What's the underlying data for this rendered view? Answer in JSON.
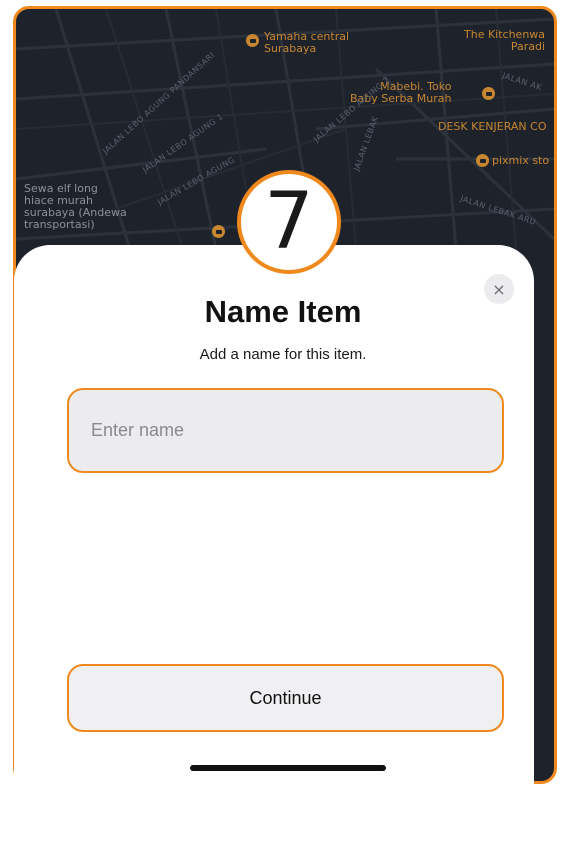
{
  "map": {
    "places": [
      {
        "name": "Yamaha central Surabaya"
      },
      {
        "name": "The Kitchenw… Paradi…"
      },
      {
        "name": "Mabebi. Toko Baby Serba Murah"
      },
      {
        "name": "DESK KENJERAN CO"
      },
      {
        "name": "pixmix sto"
      },
      {
        "name": "Sewa elf long hiace murah surabaya (Andewa transportasi)"
      }
    ],
    "streets": [
      "JALAN LEBO AGUNG PANDANSARI",
      "JALAN LEBO AGUNG 1",
      "JALAN LEBO AGUNG",
      "JALAN LEBO AGUNG 2",
      "JALAN LEBAK",
      "JALAN LEBAK ARU",
      "JALAN AK"
    ],
    "labels": {
      "yamaha": "Yamaha central\nSurabaya",
      "kitchen": "The Kitchenwa\nParadi",
      "mabebi": "Mabebi. Toko\nBaby Serba Murah",
      "desk": "DESK KENJERAN CO",
      "pixmix": "pixmix sto",
      "sewa": "Sewa elf long\nhiace murah\nsurabaya (Andewa\ntransportasi)"
    }
  },
  "step": {
    "number": "7"
  },
  "sheet": {
    "title": "Name Item",
    "subtitle": "Add a name for this item.",
    "close_glyph": "×",
    "input": {
      "placeholder": "Enter name",
      "value": ""
    },
    "continue_label": "Continue"
  },
  "colors": {
    "accent": "#f0891d",
    "map_background": "#1e232b",
    "map_label": "#c7862f",
    "input_background": "#ececef"
  },
  "icons": {
    "close": "close-icon",
    "map_pin": "map-pin-icon"
  }
}
